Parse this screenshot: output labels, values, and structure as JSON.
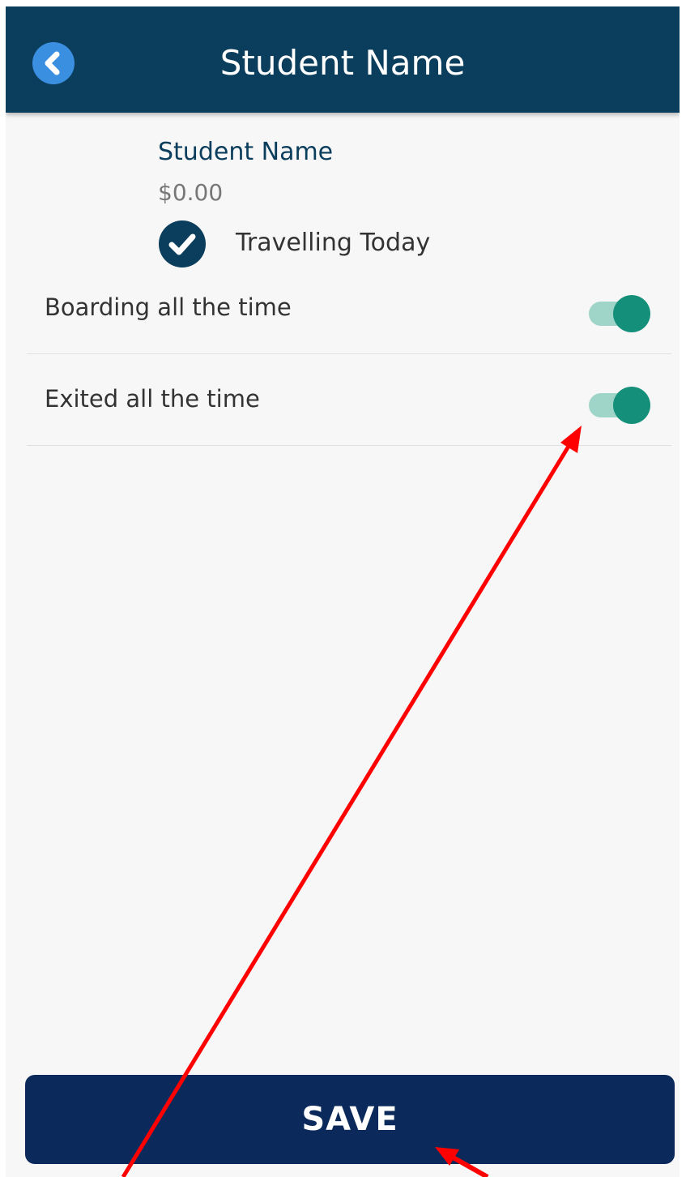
{
  "header": {
    "title": "Student Name",
    "back_icon": "chevron-left-circle-icon"
  },
  "student": {
    "name": "Student Name",
    "amount": "$0.00",
    "travelling_label": "Travelling Today",
    "travelling_checked": true
  },
  "settings": [
    {
      "label": "Boarding all the time",
      "enabled": true
    },
    {
      "label": "Exited all the time",
      "enabled": true
    }
  ],
  "footer": {
    "save_label": "SAVE"
  },
  "colors": {
    "header_bg": "#0b3d5c",
    "back_icon": "#3b8fe0",
    "toggle_on": "#14907a",
    "save_bg": "#0b2a5b",
    "annotation_arrow": "#ff0000"
  }
}
